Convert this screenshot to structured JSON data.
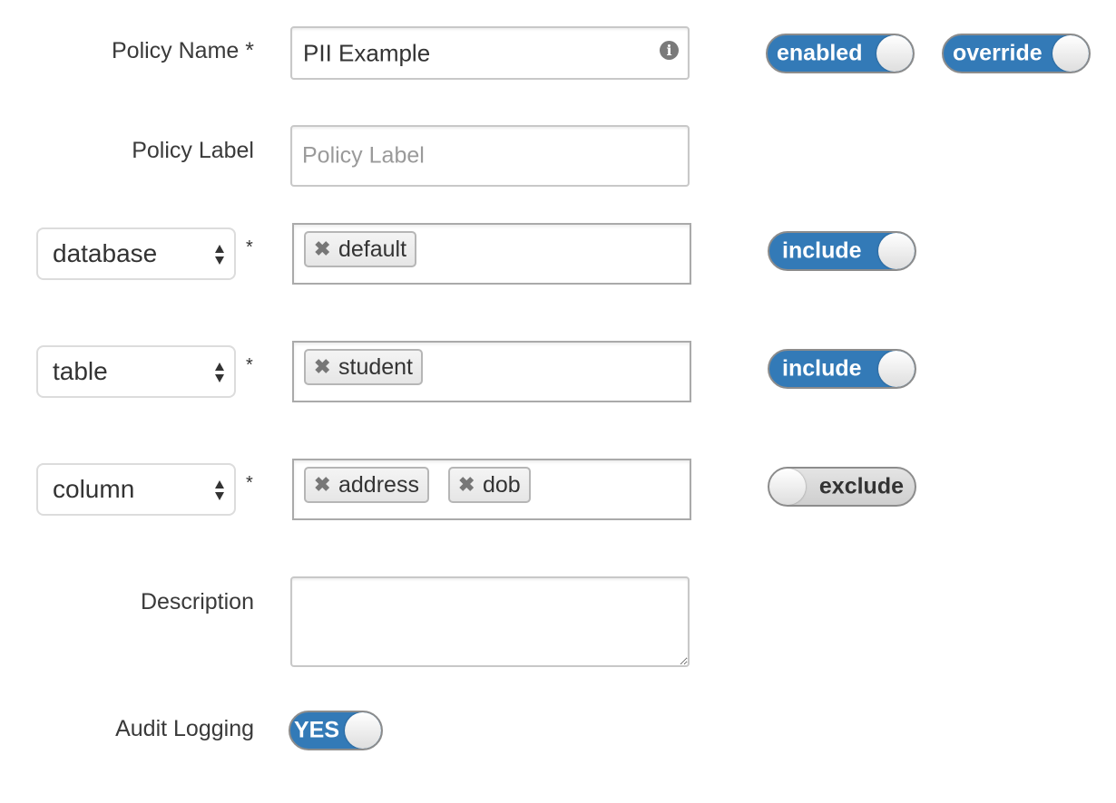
{
  "policy_name": {
    "label": "Policy Name *",
    "value": "PII Example",
    "info_icon": "info-icon"
  },
  "policy_label": {
    "label": "Policy Label",
    "placeholder": "Policy Label"
  },
  "status_toggles": {
    "enabled": "enabled",
    "override": "override"
  },
  "resources": [
    {
      "type": "database",
      "required_mark": "*",
      "tags": [
        "default"
      ],
      "toggle": "include",
      "toggle_state": "on"
    },
    {
      "type": "table",
      "required_mark": "*",
      "tags": [
        "student"
      ],
      "toggle": "include",
      "toggle_state": "on"
    },
    {
      "type": "column",
      "required_mark": "*",
      "tags": [
        "address",
        "dob"
      ],
      "toggle": "exclude",
      "toggle_state": "off"
    }
  ],
  "description": {
    "label": "Description",
    "value": ""
  },
  "audit_logging": {
    "label": "Audit Logging",
    "toggle": "YES",
    "toggle_state": "on"
  },
  "colors": {
    "accent": "#337ab7",
    "border": "#c8c8c8"
  },
  "tag_remove_glyph": "✖"
}
